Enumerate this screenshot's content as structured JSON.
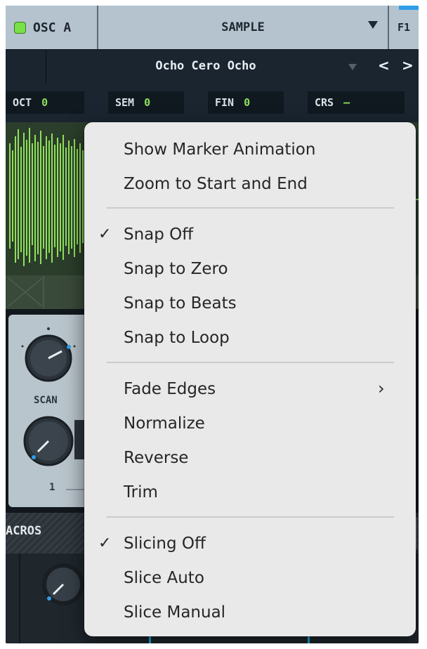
{
  "osc": {
    "label": "OSC A",
    "enabled_color": "#79e048"
  },
  "source": {
    "label": "SAMPLE",
    "filter_label": "F1"
  },
  "preset": {
    "name": "Ocho Cero Ocho",
    "prev": "<",
    "next": ">"
  },
  "tuning": [
    {
      "label": "OCT",
      "value": "0"
    },
    {
      "label": "SEM",
      "value": "0"
    },
    {
      "label": "FIN",
      "value": "0"
    },
    {
      "label": "CRS",
      "value": "–"
    }
  ],
  "knobs": {
    "scan_label": "SCAN",
    "second_value": "1"
  },
  "macros": {
    "label": "ACROS"
  },
  "colors": {
    "waveform": "#8fe05a",
    "accent": "#2f9de8",
    "menu_bg": "#e9e9e9"
  },
  "context_menu": {
    "groups": [
      {
        "items": [
          {
            "label": "Show Marker Animation",
            "checked": false
          },
          {
            "label": "Zoom to Start and End",
            "checked": false
          }
        ]
      },
      {
        "items": [
          {
            "label": "Snap Off",
            "checked": true
          },
          {
            "label": "Snap to Zero",
            "checked": false
          },
          {
            "label": "Snap to Beats",
            "checked": false
          },
          {
            "label": "Snap to Loop",
            "checked": false
          }
        ]
      },
      {
        "items": [
          {
            "label": "Fade Edges",
            "checked": false,
            "submenu": true
          },
          {
            "label": "Normalize",
            "checked": false
          },
          {
            "label": "Reverse",
            "checked": false
          },
          {
            "label": "Trim",
            "checked": false
          }
        ]
      },
      {
        "items": [
          {
            "label": "Slicing Off",
            "checked": true
          },
          {
            "label": "Slice Auto",
            "checked": false
          },
          {
            "label": "Slice Manual",
            "checked": false
          }
        ]
      }
    ],
    "check_glyph": "✓",
    "submenu_glyph": "›"
  }
}
